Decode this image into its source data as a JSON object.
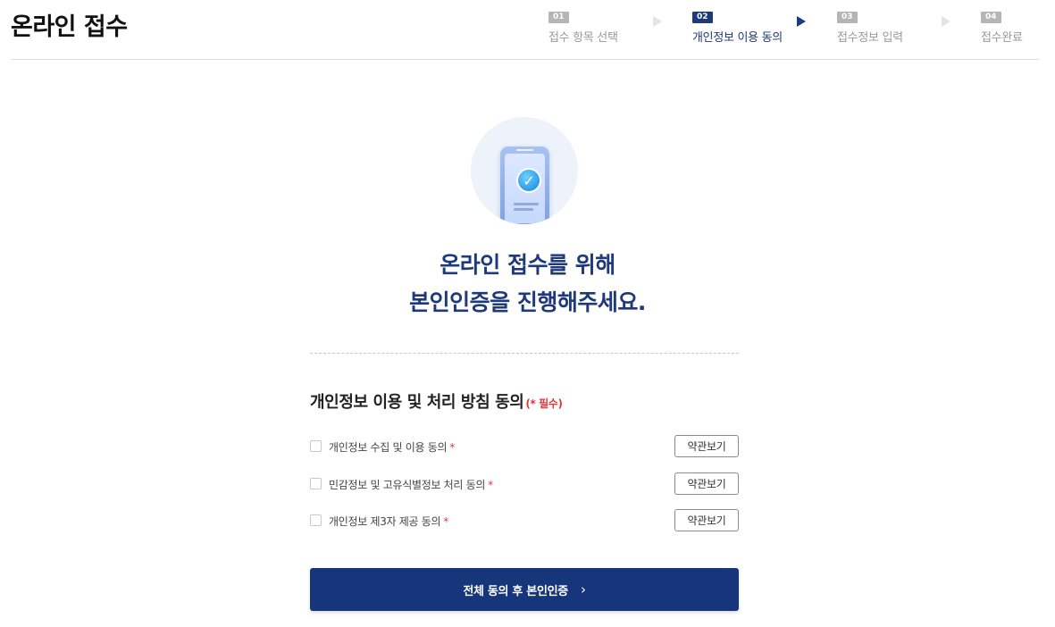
{
  "header": {
    "title": "온라인 접수"
  },
  "steps": [
    {
      "num": "01",
      "label": "접수 항목 선택",
      "active": false
    },
    {
      "num": "02",
      "label": "개인정보 이용 동의",
      "active": true
    },
    {
      "num": "03",
      "label": "접수정보 입력",
      "active": false
    },
    {
      "num": "04",
      "label": "접수완료",
      "active": false
    }
  ],
  "hero": {
    "icon": "phone-check-icon",
    "line1": "온라인 접수를 위해",
    "line2": "본인인증을 진행해주세요."
  },
  "section": {
    "title": "개인정보 이용 및 처리 방침 동의",
    "required_note": "(* 필수)"
  },
  "agreements": [
    {
      "label": "개인정보 수집 및 이용 동의",
      "required_mark": "*",
      "button": "약관보기"
    },
    {
      "label": "민감정보 및 고유식별정보 처리 동의",
      "required_mark": "*",
      "button": "약관보기"
    },
    {
      "label": "개인정보 제3자 제공 동의",
      "required_mark": "*",
      "button": "약관보기"
    }
  ],
  "submit": {
    "label": "전체 동의 후 본인인증",
    "icon": "chevron-right-icon"
  },
  "colors": {
    "accent": "#1e3a7b",
    "button": "#17357a",
    "required": "#e0383e",
    "inactive_step": "#b5b5b5"
  }
}
